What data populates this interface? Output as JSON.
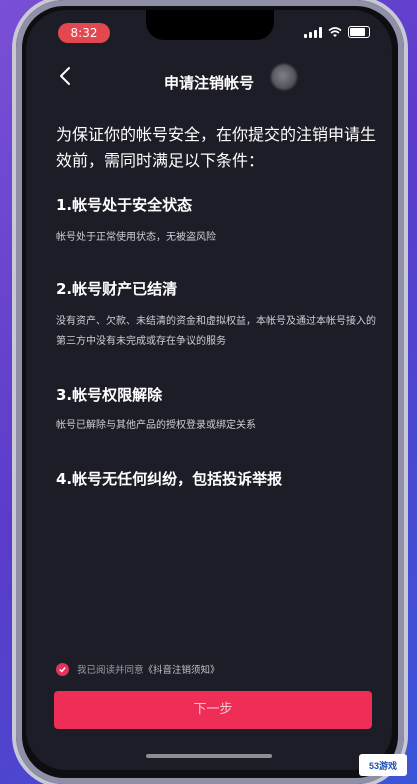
{
  "status_bar": {
    "time": "8:32"
  },
  "header": {
    "title": "申请注销帐号"
  },
  "intro": "为保证你的帐号安全，在你提交的注销申请生效前，需同时满足以下条件：",
  "conditions": [
    {
      "title": "1.帐号处于安全状态",
      "desc": "帐号处于正常使用状态，无被盗风险"
    },
    {
      "title": "2.帐号财产已结清",
      "desc": "没有资产、欠款、未结清的资金和虚拟权益，本帐号及通过本帐号接入的第三方中没有未完成或存在争议的服务"
    },
    {
      "title": "3.帐号权限解除",
      "desc": "帐号已解除与其他产品的授权登录或绑定关系"
    },
    {
      "title": "4.帐号无任何纠纷，包括投诉举报",
      "desc": ""
    }
  ],
  "agreement": {
    "prefix": "我已阅读并同意",
    "link": "《抖音注销须知》",
    "checked": true
  },
  "next_button": "下一步",
  "watermark": "53游戏",
  "colors": {
    "accent": "#ee2e57",
    "background": "#1c1d26",
    "time_pill": "#e3474f"
  }
}
